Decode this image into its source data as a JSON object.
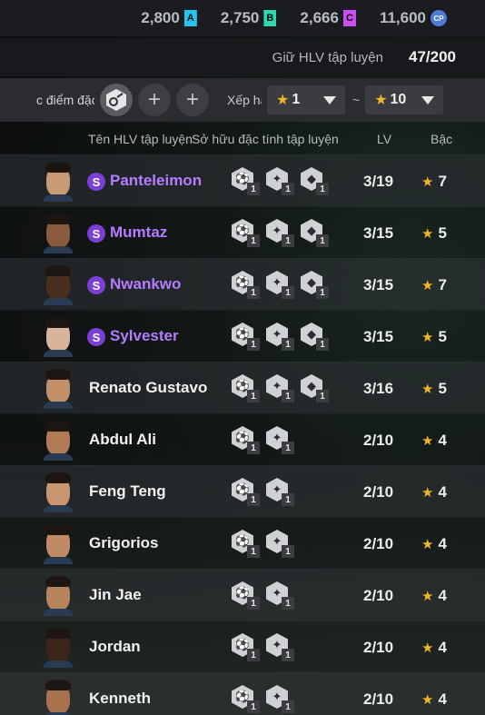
{
  "currencies": [
    {
      "amount": "2,800",
      "tag": "A",
      "color": "#25c3f0"
    },
    {
      "amount": "2,750",
      "tag": "B",
      "color": "#2fd8b0"
    },
    {
      "amount": "2,666",
      "tag": "C",
      "color": "#c64ff0"
    },
    {
      "amount": "11,600",
      "tag": "CP",
      "color": "#4f7bd8"
    }
  ],
  "holding": {
    "label": "Giữ HLV tập luyện",
    "value": "47/200"
  },
  "filter": {
    "trait_label": "c điểm đặc",
    "add_icon": "+",
    "rank_label": "Xếp hạ",
    "rank_min": "1",
    "rank_sep": "~",
    "rank_max": "10"
  },
  "header": {
    "name": "Tên HLV tập luyện",
    "traits": "Sở hữu đặc tính tập luyện",
    "lv": "LV",
    "rank": "Bậc"
  },
  "rows": [
    {
      "name": "Panteleimon",
      "special": true,
      "lv": "3/19",
      "rank": "7",
      "skin": "#c99a74",
      "traits": [
        "1",
        "1",
        "1"
      ]
    },
    {
      "name": "Mumtaz",
      "special": true,
      "lv": "3/15",
      "rank": "5",
      "skin": "#8a5a3c",
      "traits": [
        "1",
        "1",
        "1"
      ]
    },
    {
      "name": "Nwankwo",
      "special": true,
      "lv": "3/15",
      "rank": "7",
      "skin": "#4a2e20",
      "traits": [
        "1",
        "1",
        "1"
      ]
    },
    {
      "name": "Sylvester",
      "special": true,
      "lv": "3/15",
      "rank": "5",
      "skin": "#d8b49a",
      "traits": [
        "1",
        "1",
        "1"
      ]
    },
    {
      "name": "Renato Gustavo",
      "special": false,
      "lv": "3/16",
      "rank": "5",
      "skin": "#c4906a",
      "traits": [
        "1",
        "1",
        "1"
      ]
    },
    {
      "name": "Abdul Ali",
      "special": false,
      "lv": "2/10",
      "rank": "4",
      "skin": "#b07a55",
      "traits": [
        "1",
        "1"
      ]
    },
    {
      "name": "Feng Teng",
      "special": false,
      "lv": "2/10",
      "rank": "4",
      "skin": "#c99670",
      "traits": [
        "1",
        "1"
      ]
    },
    {
      "name": "Grigorios",
      "special": false,
      "lv": "2/10",
      "rank": "4",
      "skin": "#c08a66",
      "traits": [
        "1",
        "1"
      ]
    },
    {
      "name": "Jin Jae",
      "special": false,
      "lv": "2/10",
      "rank": "4",
      "skin": "#b8845e",
      "traits": [
        "1",
        "1"
      ]
    },
    {
      "name": "Jordan",
      "special": false,
      "lv": "2/10",
      "rank": "4",
      "skin": "#3c2418",
      "traits": [
        "1",
        "1"
      ]
    },
    {
      "name": "Kenneth",
      "special": false,
      "lv": "2/10",
      "rank": "4",
      "skin": "#a8724e",
      "traits": [
        "1",
        "1"
      ]
    }
  ]
}
